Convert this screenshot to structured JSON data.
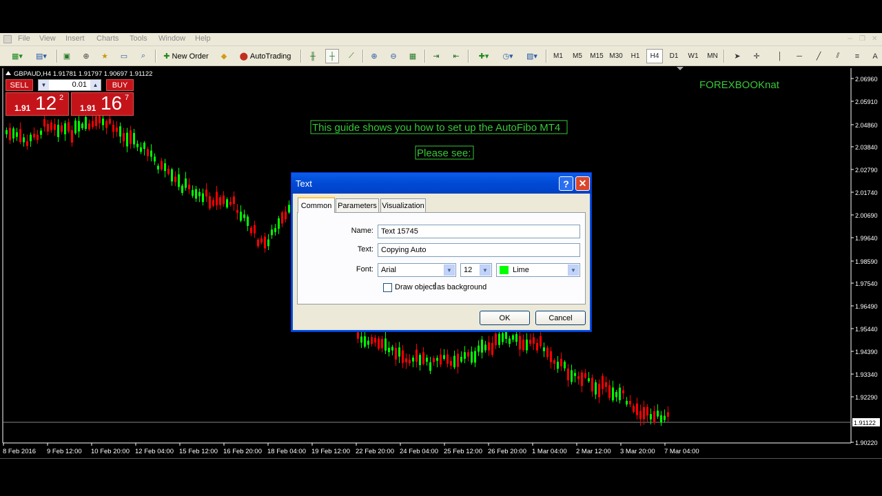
{
  "menu": [
    "File",
    "View",
    "Insert",
    "Charts",
    "Tools",
    "Window",
    "Help"
  ],
  "toolbar": {
    "new_order": "New Order",
    "autotrading": "AutoTrading",
    "timeframes": [
      "M1",
      "M5",
      "M15",
      "M30",
      "H1",
      "H4",
      "D1",
      "W1",
      "MN"
    ],
    "active_timeframe": "H4"
  },
  "chart": {
    "header": "GBPAUD,H4  1.91781 1.91797 1.90697 1.91122",
    "watermark": "FOREXBOOKnat",
    "guide_text": "This guide shows you how to set up the AutoFibo MT4",
    "please_see": "Please see:",
    "price_ticks": [
      "2.06960",
      "2.05910",
      "2.04860",
      "2.03840",
      "2.02790",
      "2.01740",
      "2.00690",
      "1.99640",
      "1.98590",
      "1.97540",
      "1.96490",
      "1.95440",
      "1.94390",
      "1.93340",
      "1.92290",
      "1.91122",
      "1.90220"
    ],
    "current_price": "1.91122",
    "time_ticks": [
      "8 Feb 2016",
      "9 Feb 12:00",
      "10 Feb 20:00",
      "12 Feb 04:00",
      "15 Feb 12:00",
      "16 Feb 20:00",
      "18 Feb 04:00",
      "19 Feb 12:00",
      "22 Feb 20:00",
      "24 Feb 04:00",
      "25 Feb 12:00",
      "26 Feb 20:00",
      "1 Mar 04:00",
      "2 Mar 12:00",
      "3 Mar 20:00",
      "7 Mar 04:00"
    ],
    "colors": {
      "bull": "#00ff00",
      "bear": "#ff0000",
      "text": "#38c838",
      "axis": "#ffffff"
    }
  },
  "one_click": {
    "sell": "SELL",
    "buy": "BUY",
    "lot": "0.01",
    "sell_price": {
      "small": "1.91",
      "big": "12",
      "sup": "2"
    },
    "buy_price": {
      "small": "1.91",
      "big": "16",
      "sup": "7"
    }
  },
  "dialog": {
    "title": "Text",
    "help": "?",
    "close": "✕",
    "tabs": [
      "Common",
      "Parameters",
      "Visualization"
    ],
    "active_tab": "Common",
    "name_label": "Name:",
    "name_value": "Text 15745",
    "text_label": "Text:",
    "text_value": "Copying Auto",
    "font_label": "Font:",
    "font_value": "Arial",
    "size_value": "12",
    "color_value": "Lime",
    "color_hex": "#00ff00",
    "background_label": "Draw object as background",
    "background_checked": false,
    "ok": "OK",
    "cancel": "Cancel"
  }
}
